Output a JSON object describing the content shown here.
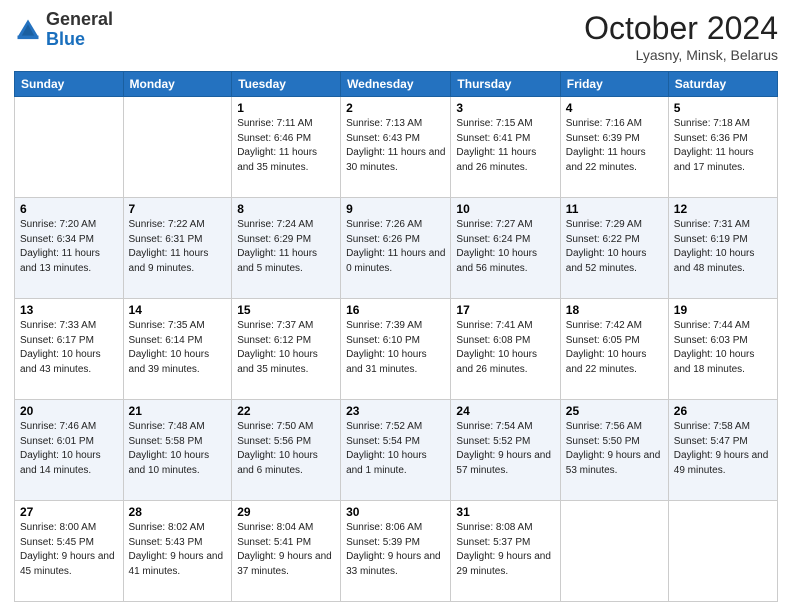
{
  "header": {
    "logo_general": "General",
    "logo_blue": "Blue",
    "month_title": "October 2024",
    "location": "Lyasny, Minsk, Belarus"
  },
  "days_of_week": [
    "Sunday",
    "Monday",
    "Tuesday",
    "Wednesday",
    "Thursday",
    "Friday",
    "Saturday"
  ],
  "weeks": [
    [
      {
        "day": "",
        "sunrise": "",
        "sunset": "",
        "daylight": ""
      },
      {
        "day": "",
        "sunrise": "",
        "sunset": "",
        "daylight": ""
      },
      {
        "day": "1",
        "sunrise": "Sunrise: 7:11 AM",
        "sunset": "Sunset: 6:46 PM",
        "daylight": "Daylight: 11 hours and 35 minutes."
      },
      {
        "day": "2",
        "sunrise": "Sunrise: 7:13 AM",
        "sunset": "Sunset: 6:43 PM",
        "daylight": "Daylight: 11 hours and 30 minutes."
      },
      {
        "day": "3",
        "sunrise": "Sunrise: 7:15 AM",
        "sunset": "Sunset: 6:41 PM",
        "daylight": "Daylight: 11 hours and 26 minutes."
      },
      {
        "day": "4",
        "sunrise": "Sunrise: 7:16 AM",
        "sunset": "Sunset: 6:39 PM",
        "daylight": "Daylight: 11 hours and 22 minutes."
      },
      {
        "day": "5",
        "sunrise": "Sunrise: 7:18 AM",
        "sunset": "Sunset: 6:36 PM",
        "daylight": "Daylight: 11 hours and 17 minutes."
      }
    ],
    [
      {
        "day": "6",
        "sunrise": "Sunrise: 7:20 AM",
        "sunset": "Sunset: 6:34 PM",
        "daylight": "Daylight: 11 hours and 13 minutes."
      },
      {
        "day": "7",
        "sunrise": "Sunrise: 7:22 AM",
        "sunset": "Sunset: 6:31 PM",
        "daylight": "Daylight: 11 hours and 9 minutes."
      },
      {
        "day": "8",
        "sunrise": "Sunrise: 7:24 AM",
        "sunset": "Sunset: 6:29 PM",
        "daylight": "Daylight: 11 hours and 5 minutes."
      },
      {
        "day": "9",
        "sunrise": "Sunrise: 7:26 AM",
        "sunset": "Sunset: 6:26 PM",
        "daylight": "Daylight: 11 hours and 0 minutes."
      },
      {
        "day": "10",
        "sunrise": "Sunrise: 7:27 AM",
        "sunset": "Sunset: 6:24 PM",
        "daylight": "Daylight: 10 hours and 56 minutes."
      },
      {
        "day": "11",
        "sunrise": "Sunrise: 7:29 AM",
        "sunset": "Sunset: 6:22 PM",
        "daylight": "Daylight: 10 hours and 52 minutes."
      },
      {
        "day": "12",
        "sunrise": "Sunrise: 7:31 AM",
        "sunset": "Sunset: 6:19 PM",
        "daylight": "Daylight: 10 hours and 48 minutes."
      }
    ],
    [
      {
        "day": "13",
        "sunrise": "Sunrise: 7:33 AM",
        "sunset": "Sunset: 6:17 PM",
        "daylight": "Daylight: 10 hours and 43 minutes."
      },
      {
        "day": "14",
        "sunrise": "Sunrise: 7:35 AM",
        "sunset": "Sunset: 6:14 PM",
        "daylight": "Daylight: 10 hours and 39 minutes."
      },
      {
        "day": "15",
        "sunrise": "Sunrise: 7:37 AM",
        "sunset": "Sunset: 6:12 PM",
        "daylight": "Daylight: 10 hours and 35 minutes."
      },
      {
        "day": "16",
        "sunrise": "Sunrise: 7:39 AM",
        "sunset": "Sunset: 6:10 PM",
        "daylight": "Daylight: 10 hours and 31 minutes."
      },
      {
        "day": "17",
        "sunrise": "Sunrise: 7:41 AM",
        "sunset": "Sunset: 6:08 PM",
        "daylight": "Daylight: 10 hours and 26 minutes."
      },
      {
        "day": "18",
        "sunrise": "Sunrise: 7:42 AM",
        "sunset": "Sunset: 6:05 PM",
        "daylight": "Daylight: 10 hours and 22 minutes."
      },
      {
        "day": "19",
        "sunrise": "Sunrise: 7:44 AM",
        "sunset": "Sunset: 6:03 PM",
        "daylight": "Daylight: 10 hours and 18 minutes."
      }
    ],
    [
      {
        "day": "20",
        "sunrise": "Sunrise: 7:46 AM",
        "sunset": "Sunset: 6:01 PM",
        "daylight": "Daylight: 10 hours and 14 minutes."
      },
      {
        "day": "21",
        "sunrise": "Sunrise: 7:48 AM",
        "sunset": "Sunset: 5:58 PM",
        "daylight": "Daylight: 10 hours and 10 minutes."
      },
      {
        "day": "22",
        "sunrise": "Sunrise: 7:50 AM",
        "sunset": "Sunset: 5:56 PM",
        "daylight": "Daylight: 10 hours and 6 minutes."
      },
      {
        "day": "23",
        "sunrise": "Sunrise: 7:52 AM",
        "sunset": "Sunset: 5:54 PM",
        "daylight": "Daylight: 10 hours and 1 minute."
      },
      {
        "day": "24",
        "sunrise": "Sunrise: 7:54 AM",
        "sunset": "Sunset: 5:52 PM",
        "daylight": "Daylight: 9 hours and 57 minutes."
      },
      {
        "day": "25",
        "sunrise": "Sunrise: 7:56 AM",
        "sunset": "Sunset: 5:50 PM",
        "daylight": "Daylight: 9 hours and 53 minutes."
      },
      {
        "day": "26",
        "sunrise": "Sunrise: 7:58 AM",
        "sunset": "Sunset: 5:47 PM",
        "daylight": "Daylight: 9 hours and 49 minutes."
      }
    ],
    [
      {
        "day": "27",
        "sunrise": "Sunrise: 8:00 AM",
        "sunset": "Sunset: 5:45 PM",
        "daylight": "Daylight: 9 hours and 45 minutes."
      },
      {
        "day": "28",
        "sunrise": "Sunrise: 8:02 AM",
        "sunset": "Sunset: 5:43 PM",
        "daylight": "Daylight: 9 hours and 41 minutes."
      },
      {
        "day": "29",
        "sunrise": "Sunrise: 8:04 AM",
        "sunset": "Sunset: 5:41 PM",
        "daylight": "Daylight: 9 hours and 37 minutes."
      },
      {
        "day": "30",
        "sunrise": "Sunrise: 8:06 AM",
        "sunset": "Sunset: 5:39 PM",
        "daylight": "Daylight: 9 hours and 33 minutes."
      },
      {
        "day": "31",
        "sunrise": "Sunrise: 8:08 AM",
        "sunset": "Sunset: 5:37 PM",
        "daylight": "Daylight: 9 hours and 29 minutes."
      },
      {
        "day": "",
        "sunrise": "",
        "sunset": "",
        "daylight": ""
      },
      {
        "day": "",
        "sunrise": "",
        "sunset": "",
        "daylight": ""
      }
    ]
  ]
}
